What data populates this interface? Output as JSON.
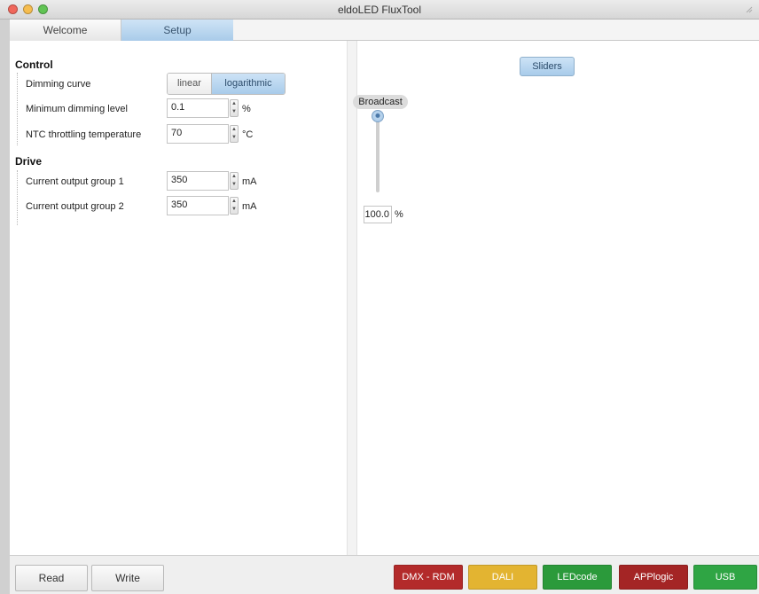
{
  "window": {
    "title": "eldoLED FluxTool"
  },
  "tabs": [
    {
      "label": "Welcome",
      "active": false
    },
    {
      "label": "Setup",
      "active": true
    }
  ],
  "control": {
    "title": "Control",
    "dimming_curve": {
      "label": "Dimming curve",
      "options": [
        "linear",
        "logarithmic"
      ],
      "selected": "logarithmic"
    },
    "min_dimming": {
      "label": "Minimum dimming level",
      "value": "0.1",
      "unit": "%"
    },
    "ntc": {
      "label": "NTC throttling temperature",
      "value": "70",
      "unit": "°C"
    }
  },
  "drive": {
    "title": "Drive",
    "group1": {
      "label": "Current output group 1",
      "value": "350",
      "unit": "mA"
    },
    "group2": {
      "label": "Current output group 2",
      "value": "350",
      "unit": "mA"
    }
  },
  "sliders": {
    "button": "Sliders",
    "channel": "Broadcast",
    "value": "100.0",
    "unit": "%",
    "level_fraction": 1.0
  },
  "bottom": {
    "read": "Read",
    "write": "Write",
    "status": [
      {
        "label": "DMX - RDM",
        "color": "#b32a2a"
      },
      {
        "label": "DALI",
        "color": "#e3b431"
      },
      {
        "label": "LEDcode",
        "color": "#2b9a3b"
      },
      {
        "label": "APPlogic",
        "color": "#a42525"
      },
      {
        "label": "USB",
        "color": "#2fa544"
      }
    ]
  },
  "colors": {
    "accent": "#a9cbe9",
    "window_bg": "#ececec"
  }
}
